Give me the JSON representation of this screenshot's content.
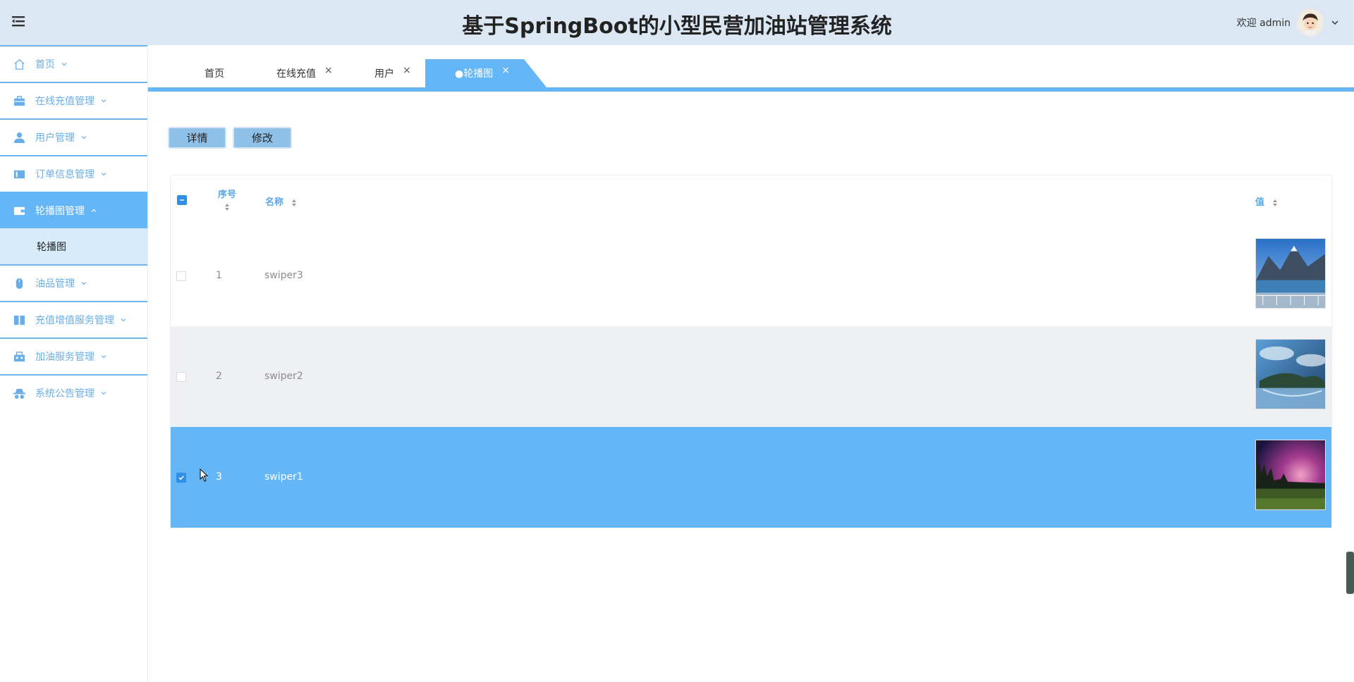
{
  "header": {
    "title": "基于SpringBoot的小型民营加油站管理系统",
    "welcome": "欢迎 admin"
  },
  "sidebar": {
    "items": [
      {
        "label": "首页",
        "icon": "home-icon"
      },
      {
        "label": "在线充值管理",
        "icon": "briefcase-icon"
      },
      {
        "label": "用户管理",
        "icon": "user-icon"
      },
      {
        "label": "订单信息管理",
        "icon": "order-icon"
      },
      {
        "label": "轮播图管理",
        "icon": "wallet-icon",
        "active": true
      },
      {
        "label": "油品管理",
        "icon": "mouse-icon"
      },
      {
        "label": "充值增值服务管理",
        "icon": "book-icon"
      },
      {
        "label": "加油服务管理",
        "icon": "toolbox-icon"
      },
      {
        "label": "系统公告管理",
        "icon": "spy-icon"
      }
    ],
    "sub_item": "轮播图"
  },
  "tabs": [
    {
      "label": "首页",
      "closable": false
    },
    {
      "label": "在线充值",
      "closable": true
    },
    {
      "label": "用户",
      "closable": true
    },
    {
      "label": "●轮播图",
      "closable": true,
      "active": true
    }
  ],
  "tab_close": "×",
  "toolbar": {
    "detail_label": "详情",
    "edit_label": "修改"
  },
  "table": {
    "columns": {
      "index": "序号",
      "name": "名称",
      "value": "值"
    },
    "rows": [
      {
        "index": "1",
        "name": "swiper3",
        "checked": false
      },
      {
        "index": "2",
        "name": "swiper2",
        "checked": false
      },
      {
        "index": "3",
        "name": "swiper1",
        "checked": true
      }
    ]
  },
  "colors": {
    "accent": "#64b6f7",
    "header_bg": "#dbe7f3",
    "link": "#6aaee8"
  }
}
